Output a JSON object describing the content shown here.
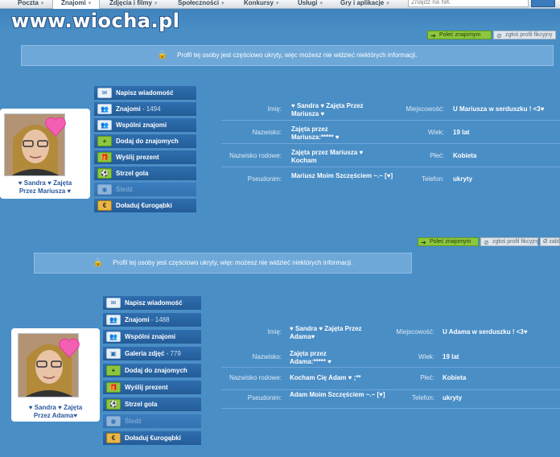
{
  "nav": {
    "tabs": [
      {
        "label": "Poczta"
      },
      {
        "label": "Znajomi"
      },
      {
        "label": "Zdjęcia i filmy"
      },
      {
        "label": "Społeczności"
      },
      {
        "label": "Konkursy"
      },
      {
        "label": "Usługi"
      },
      {
        "label": "Gry i aplikacje"
      }
    ],
    "search_placeholder": "Znajdź na NK"
  },
  "watermark": "www.wiocha.pl",
  "profiles": [
    {
      "actions": {
        "add_friend": "Poleć znajomym",
        "report": "zgłoś profil fikcyjny"
      },
      "notice": "Profil tej osoby jest częściowo ukryty, więc możesz nie widzieć niektórych informacji.",
      "caption_line1": "♥ Sandra ♥ Zajęta",
      "caption_line2": "Przez Mariusza ♥",
      "menu": [
        {
          "label": "Napisz wiadomość",
          "count": "",
          "icon": "envelope-icon"
        },
        {
          "label": "Znajomi",
          "count": " - 1494",
          "icon": "people-icon"
        },
        {
          "label": "Wspólni znajomi",
          "count": "",
          "icon": "people-icon"
        },
        {
          "label": "Dodaj do znajomych",
          "count": "",
          "icon": "add-friend-icon"
        },
        {
          "label": "Wyślij prezent",
          "count": "",
          "icon": "gift-icon"
        },
        {
          "label": "Strzel gola",
          "count": "",
          "icon": "ball-icon"
        },
        {
          "label": "Śledź",
          "count": "",
          "icon": "follow-icon"
        },
        {
          "label": "Doładuj €urogąbki",
          "count": "",
          "icon": "coin-icon"
        }
      ],
      "fields": {
        "imie_label": "Imię:",
        "imie": "♥ Sandra ♥ Zajęta Przez Mariusza ♥",
        "nazwisko_label": "Nazwisko:",
        "nazwisko": "Zajęta przez Mariusza:***** ♥",
        "rodowe_label": "Nazwisko rodowe:",
        "rodowe": "Zajęta przez Mariusza ♥ Kocham",
        "pseudonim_label": "Pseudonim:",
        "pseudonim": "Mariusz Moim Szczęściem ~.~ [♥]",
        "miejsc_label": "Miejscowość:",
        "miejsc": "U Mariusza w serduszku ! <3♥",
        "wiek_label": "Wiek:",
        "wiek": "19 lat",
        "plec_label": "Płeć:",
        "plec": "Kobieta",
        "telefon_label": "Telefon:",
        "telefon": "ukryty"
      }
    },
    {
      "actions": {
        "add_friend": "Poleć znajomym",
        "report": "zgłoś profil fikcyjny",
        "extra": "Ø zabl"
      },
      "notice": "Profil tej osoby jest częściowo ukryty, więc możesz nie widzieć niektórych informacji.",
      "caption_line1": "♥ Sandra ♥ Zajęta",
      "caption_line2": "Przez Adama♥",
      "menu": [
        {
          "label": "Napisz wiadomość",
          "count": "",
          "icon": "envelope-icon"
        },
        {
          "label": "Znajomi",
          "count": " - 1488",
          "icon": "people-icon"
        },
        {
          "label": "Wspólni znajomi",
          "count": "",
          "icon": "people-icon"
        },
        {
          "label": "Galeria zdjęć",
          "count": " - 779",
          "icon": "gallery-icon"
        },
        {
          "label": "Dodaj do znajomych",
          "count": "",
          "icon": "add-friend-icon"
        },
        {
          "label": "Wyślij prezent",
          "count": "",
          "icon": "gift-icon"
        },
        {
          "label": "Strzel gola",
          "count": "",
          "icon": "ball-icon"
        },
        {
          "label": "Śledź",
          "count": "",
          "icon": "follow-icon"
        },
        {
          "label": "Doładuj €urogąbki",
          "count": "",
          "icon": "coin-icon"
        }
      ],
      "fields": {
        "imie_label": "Imię:",
        "imie": "♥ Sandra ♥ Zajęta Przez Adama♥",
        "nazwisko_label": "Nazwisko:",
        "nazwisko": "Zajęta przez Adama:***** ♥",
        "rodowe_label": "Nazwisko rodowe:",
        "rodowe": "Kocham Cię Adam ♥ ;**",
        "pseudonim_label": "Pseudonim:",
        "pseudonim": "Adam Moim Szczęściem ~.~ [♥]",
        "miejsc_label": "Miejscowość:",
        "miejsc": "U Adama w serduszku ! <3♥",
        "wiek_label": "Wiek:",
        "wiek": "19 lat",
        "plec_label": "Płeć:",
        "plec": "Kobieta",
        "telefon_label": "Telefon:",
        "telefon": "ukryty"
      }
    }
  ]
}
